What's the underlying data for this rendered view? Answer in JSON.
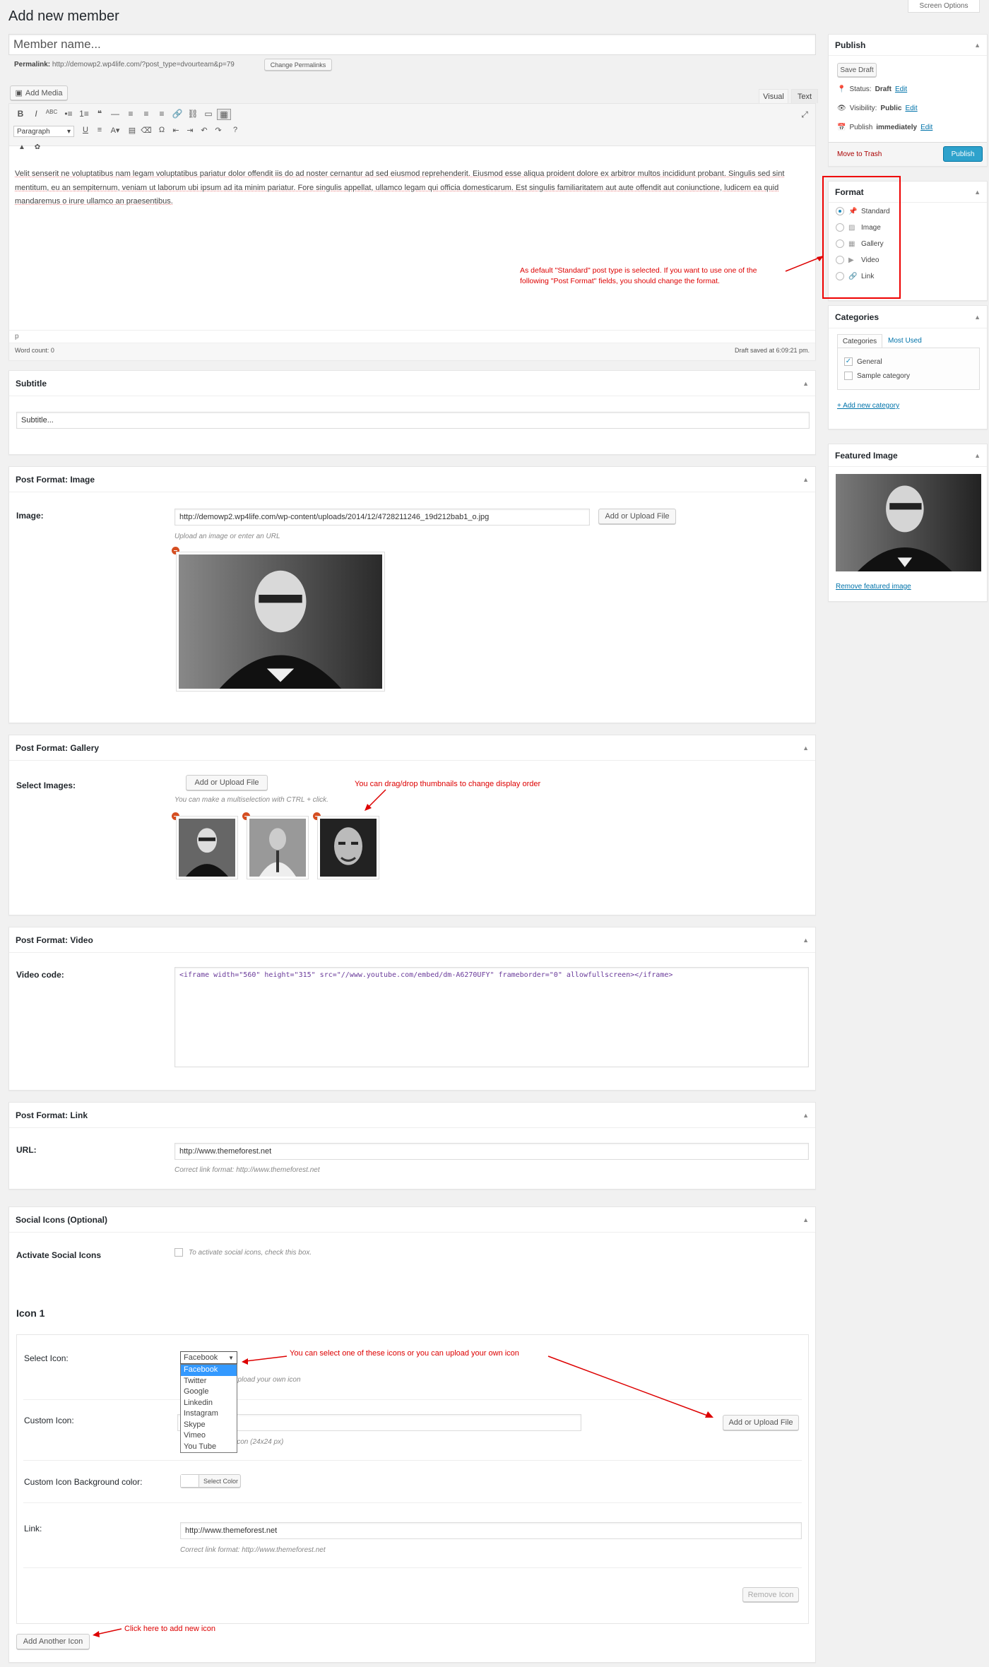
{
  "screen_options": "Screen Options",
  "page_title": "Add new member",
  "title_placeholder": "Member name...",
  "permalink": {
    "label": "Permalink:",
    "url": "http://demowp2.wp4life.com/?post_type=dvourteam&p=79",
    "button": "Change Permalinks"
  },
  "editor": {
    "add_media": "Add Media",
    "tab_visual": "Visual",
    "tab_text": "Text",
    "format_select": "Paragraph",
    "content": "Velit senserit ne voluptatibus nam legam voluptatibus pariatur dolor offendit iis do ad noster cernantur ad sed eiusmod reprehenderit. Eiusmod esse aliqua proident dolore ex arbitror multos incididunt probant. Singulis sed sint mentitum, eu an sempiternum, veniam ut laborum ubi ipsum ad ita minim pariatur. Fore singulis appellat, ullamco legam qui officia domesticarum. Est singulis familiaritatem aut aute offendit aut coniunctione, ludicem ea quid mandaremus o irure ullamco an praesentibus.",
    "path": "p",
    "word_count": "Word count: 0",
    "draft_saved": "Draft saved at 6:09:21 pm.",
    "toolbar_icons": [
      "bold-icon",
      "italic-icon",
      "strikethrough-icon",
      "bullet-list-icon",
      "numbered-list-icon",
      "blockquote-icon",
      "horizontal-rule-icon",
      "align-left-icon",
      "align-center-icon",
      "align-right-icon",
      "link-icon",
      "unlink-icon",
      "insert-more-icon",
      "toolbar-toggle-icon"
    ],
    "toolbar_glyphs": [
      "B",
      "I",
      "ABC",
      "•≡",
      "1≡",
      "❝",
      "—",
      "≡",
      "≡",
      "≡",
      "🔗",
      "⛓",
      "▭",
      "▦"
    ],
    "toolbar2_glyphs": [
      "U",
      "≡",
      "A▾",
      "▤",
      "⌫",
      "Ω",
      "⇤",
      "⇥",
      "↶",
      "↷",
      "?"
    ],
    "toolbar2_icons": [
      "underline-icon",
      "justify-icon",
      "text-color-icon",
      "paste-text-icon",
      "clear-formatting-icon",
      "special-character-icon",
      "outdent-icon",
      "indent-icon",
      "undo-icon",
      "redo-icon",
      "help-icon"
    ]
  },
  "annotations": {
    "format": "As default \"Standard\" post type is selected. If you want to use one of the following \"Post Format\" fields, you should change the format.",
    "gallery": "You can drag/drop thumbnails to change display order",
    "icons": "You can select one of these icons or you can upload your own icon",
    "add_icon": "Click here to add new icon"
  },
  "subtitle": {
    "title": "Subtitle",
    "placeholder": "Subtitle..."
  },
  "pf_image": {
    "title": "Post Format: Image",
    "label": "Image:",
    "value": "http://demowp2.wp4life.com/wp-content/uploads/2014/12/4728211246_19d212bab1_o.jpg",
    "button": "Add or Upload File",
    "desc": "Upload an image or enter an URL"
  },
  "pf_gallery": {
    "title": "Post Format: Gallery",
    "label": "Select Images:",
    "button": "Add or Upload File",
    "desc": "You can make a multiselection with CTRL + click."
  },
  "pf_video": {
    "title": "Post Format: Video",
    "label": "Video code:",
    "value": "<iframe width=\"560\" height=\"315\" src=\"//www.youtube.com/embed/dm-A6270UFY\" frameborder=\"0\" allowfullscreen></iframe>"
  },
  "pf_link": {
    "title": "Post Format: Link",
    "label": "URL:",
    "value": "http://www.themeforest.net",
    "desc": "Correct link format: http://www.themeforest.net"
  },
  "social": {
    "title": "Social Icons (Optional)",
    "activate_label": "Activate Social Icons",
    "activate_desc": "To activate social icons, check this box.",
    "icon_heading": "Icon 1",
    "select_label": "Select Icon:",
    "select_value": "Facebook",
    "options": [
      "Facebook",
      "Twitter",
      "Google",
      "Linkedin",
      "Instagram",
      "Skype",
      "Vimeo",
      "You Tube"
    ],
    "select_desc": "upload your own icon",
    "custom_label": "Custom Icon:",
    "custom_button": "Add or Upload File",
    "custom_desc": "icon (24x24 px)",
    "bg_label": "Custom Icon Background color:",
    "bg_button": "Select Color",
    "link_label": "Link:",
    "link_value": "http://www.themeforest.net",
    "link_desc": "Correct link format: http://www.themeforest.net",
    "remove_button": "Remove Icon",
    "add_button": "Add Another Icon"
  },
  "publish": {
    "title": "Publish",
    "save_draft": "Save Draft",
    "status_label": "Status:",
    "status_value": "Draft",
    "status_edit": "Edit",
    "visibility_label": "Visibility:",
    "visibility_value": "Public",
    "visibility_edit": "Edit",
    "publish_label": "Publish",
    "publish_value": "immediately",
    "publish_edit": "Edit",
    "trash": "Move to Trash",
    "publish_button": "Publish",
    "accent": "#2ea2cc"
  },
  "format": {
    "title": "Format",
    "options": [
      "Standard",
      "Image",
      "Gallery",
      "Video",
      "Link"
    ],
    "selected": "Standard"
  },
  "categories": {
    "title": "Categories",
    "tab_all": "Categories",
    "tab_used": "Most Used",
    "items": [
      "General",
      "Sample category"
    ],
    "add_new": "+ Add new category"
  },
  "featured": {
    "title": "Featured Image",
    "remove": "Remove featured image"
  }
}
